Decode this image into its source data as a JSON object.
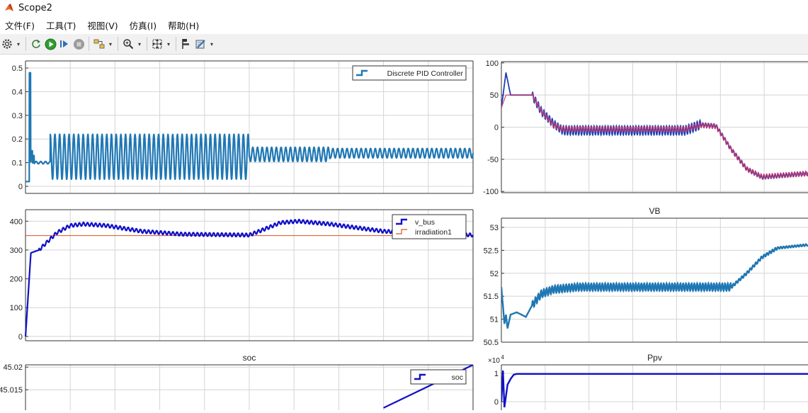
{
  "window": {
    "title": "Scope2"
  },
  "menu": [
    "文件(F)",
    "工具(T)",
    "视图(V)",
    "仿真(I)",
    "帮助(H)"
  ],
  "toolbar": {
    "buttons": [
      "gear-icon",
      "refresh-icon",
      "run-icon",
      "step-forward-icon",
      "stop-icon",
      "signal-select-icon",
      "zoom-icon",
      "fit-view-icon",
      "cursor-icon",
      "style-icon"
    ]
  },
  "colors": {
    "pid": "#1f77b4",
    "v_bus": "#1010c8",
    "irradiation1": "#d95319",
    "vb": "#1f77b4",
    "soc": "#1010c8",
    "ppv": "#1010c8",
    "tr_blue": "#1e3fb0",
    "tr_red": "#d0306a",
    "grid": "#d4d4d4"
  },
  "chart_data": [
    {
      "id": "pid",
      "type": "line",
      "title": "",
      "ylim": [
        -0.03,
        0.53
      ],
      "yticks": [
        "0",
        "0.1",
        "0.2",
        "0.3",
        "0.4",
        "0.5"
      ],
      "grid": true,
      "legend": {
        "placement": "top-right",
        "entries": [
          "Discrete PID Controller"
        ]
      },
      "series": [
        {
          "name": "Discrete PID Controller",
          "color": "pid",
          "segments": [
            {
              "t": [
                0.0,
                0.01
              ],
              "center": 0.02,
              "amp": 0.0
            },
            {
              "t": [
                0.01,
                0.055
              ],
              "center": 0.1,
              "amp": 0.005
            },
            {
              "t": [
                0.055,
                0.5
              ],
              "center": 0.125,
              "amp": 0.095
            },
            {
              "t": [
                0.5,
                0.68
              ],
              "center": 0.135,
              "amp": 0.03
            },
            {
              "t": [
                0.68,
                1.0
              ],
              "center": 0.14,
              "amp": 0.02
            }
          ],
          "spikes": [
            [
              0.01,
              0.48
            ],
            [
              0.014,
              0.15
            ],
            [
              0.018,
              0.13
            ]
          ]
        }
      ]
    },
    {
      "id": "tr",
      "type": "line",
      "title": "",
      "ylim": [
        -102,
        102
      ],
      "yticks": [
        "-100",
        "-50",
        "0",
        "50",
        "100"
      ],
      "grid": true,
      "series": [
        {
          "name": "",
          "color": "tr_blue",
          "points": [
            [
              0,
              30
            ],
            [
              0.015,
              85
            ],
            [
              0.03,
              50
            ],
            [
              0.1,
              50
            ],
            [
              0.13,
              25
            ],
            [
              0.17,
              5
            ],
            [
              0.2,
              -5
            ],
            [
              0.6,
              -5
            ],
            [
              0.65,
              4
            ],
            [
              0.7,
              2
            ],
            [
              0.75,
              -35
            ],
            [
              0.8,
              -65
            ],
            [
              0.85,
              -78
            ],
            [
              1.0,
              -72
            ]
          ],
          "osc": [
            [
              0.1,
              0.2,
              6
            ],
            [
              0.2,
              0.65,
              7
            ],
            [
              0.65,
              1.0,
              3
            ]
          ]
        },
        {
          "name": "",
          "color": "tr_red",
          "points": [
            [
              0,
              30
            ],
            [
              0.015,
              50
            ],
            [
              0.1,
              50
            ],
            [
              0.13,
              25
            ],
            [
              0.17,
              3
            ],
            [
              0.2,
              -3
            ],
            [
              0.6,
              -3
            ],
            [
              0.65,
              3
            ],
            [
              0.7,
              1
            ],
            [
              0.75,
              -35
            ],
            [
              0.8,
              -65
            ],
            [
              0.85,
              -77
            ],
            [
              1.0,
              -72
            ]
          ]
        }
      ]
    },
    {
      "id": "vbus",
      "type": "line",
      "title": "",
      "ylim": [
        -15,
        440
      ],
      "yticks": [
        "0",
        "100",
        "200",
        "300",
        "400"
      ],
      "grid": true,
      "legend": {
        "placement": "top-right",
        "entries": [
          "v_bus",
          "irradiation1"
        ]
      },
      "series": [
        {
          "name": "v_bus",
          "color": "v_bus",
          "points": [
            [
              0,
              0
            ],
            [
              0.012,
              290
            ],
            [
              0.03,
              300
            ],
            [
              0.07,
              360
            ],
            [
              0.1,
              385
            ],
            [
              0.13,
              390
            ],
            [
              0.18,
              385
            ],
            [
              0.26,
              365
            ],
            [
              0.35,
              355
            ],
            [
              0.5,
              352
            ],
            [
              0.53,
              370
            ],
            [
              0.57,
              395
            ],
            [
              0.61,
              400
            ],
            [
              0.68,
              390
            ],
            [
              0.8,
              365
            ],
            [
              1.0,
              352
            ]
          ],
          "osc_amp": 6
        },
        {
          "name": "irradiation1",
          "color": "irradiation1",
          "points": [
            [
              0,
              350
            ],
            [
              1.0,
              350
            ]
          ]
        }
      ]
    },
    {
      "id": "vb",
      "type": "line",
      "title": "VB",
      "ylim": [
        50.5,
        53.2
      ],
      "yticks": [
        "50.5",
        "51",
        "51.5",
        "52",
        "52.5",
        "53"
      ],
      "grid": true,
      "series": [
        {
          "name": "",
          "color": "vb",
          "points": [
            [
              0,
              51.7
            ],
            [
              0.01,
              50.9
            ],
            [
              0.015,
              51.1
            ],
            [
              0.02,
              50.8
            ],
            [
              0.03,
              51.1
            ],
            [
              0.05,
              51.15
            ],
            [
              0.08,
              51.05
            ],
            [
              0.1,
              51.3
            ],
            [
              0.13,
              51.55
            ],
            [
              0.17,
              51.65
            ],
            [
              0.25,
              51.7
            ],
            [
              0.75,
              51.7
            ],
            [
              0.8,
              52.0
            ],
            [
              0.85,
              52.35
            ],
            [
              0.9,
              52.55
            ],
            [
              1.0,
              52.62
            ]
          ],
          "osc": [
            [
              0.1,
              0.75,
              0.08
            ],
            [
              0.75,
              0.9,
              0.03
            ],
            [
              0.9,
              1.0,
              0.02
            ]
          ]
        }
      ]
    },
    {
      "id": "soc",
      "type": "line",
      "title": "soc",
      "ylim": [
        45.0105,
        45.0205
      ],
      "yticks": [
        "45.015",
        "45.02"
      ],
      "grid": true,
      "legend": {
        "placement": "top-right",
        "entries": [
          "soc"
        ]
      },
      "series": [
        {
          "name": "soc",
          "color": "soc",
          "points": [
            [
              0.8,
              45.011
            ],
            [
              1.0,
              45.0205
            ]
          ]
        }
      ]
    },
    {
      "id": "ppv",
      "type": "line",
      "title": "Ppv",
      "exponent": "×10",
      "exponent_power": "4",
      "ylim": [
        -0.3,
        1.3
      ],
      "yticks": [
        "0",
        "1"
      ],
      "grid": true,
      "series": [
        {
          "name": "",
          "color": "ppv",
          "points": [
            [
              0,
              0
            ],
            [
              0.005,
              1.1
            ],
            [
              0.01,
              -0.2
            ],
            [
              0.02,
              0.6
            ],
            [
              0.03,
              0.8
            ],
            [
              0.04,
              0.95
            ],
            [
              0.05,
              0.98
            ],
            [
              1.0,
              0.98
            ]
          ]
        }
      ]
    }
  ]
}
